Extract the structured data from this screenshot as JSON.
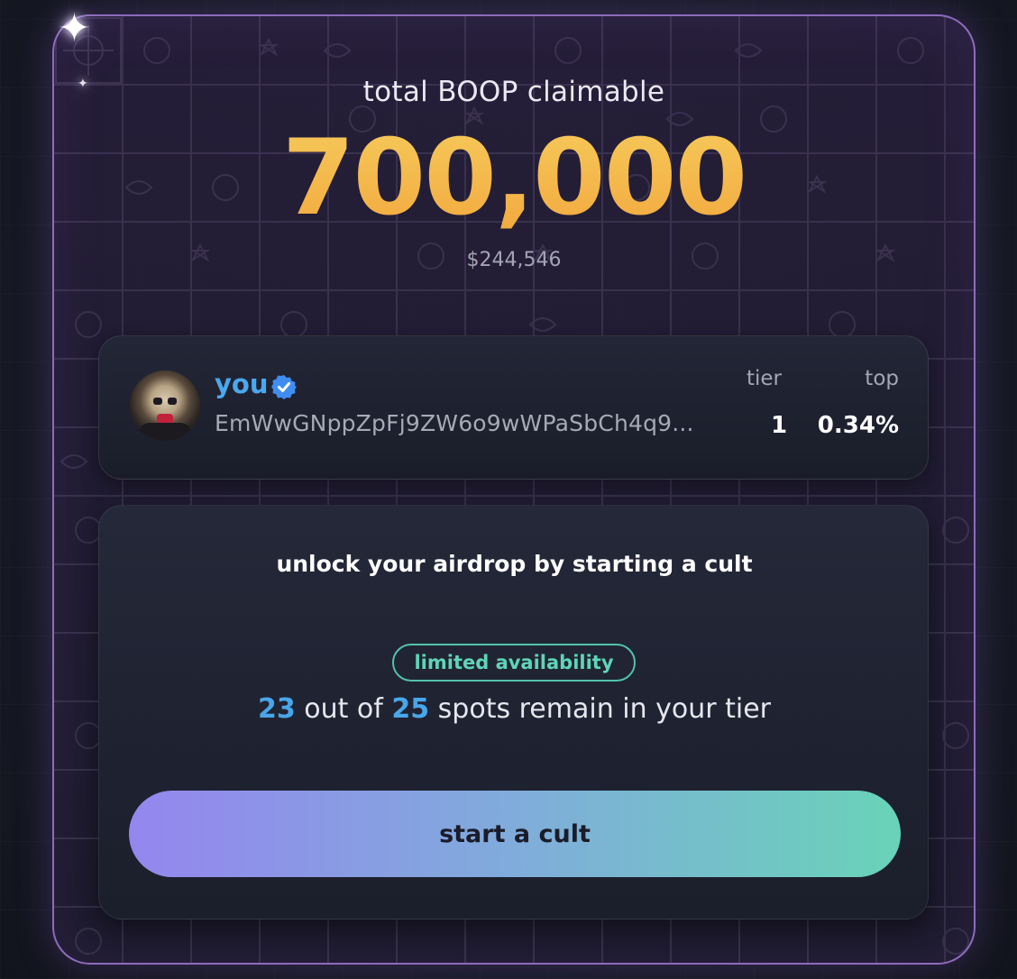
{
  "claim": {
    "label": "total BOOP claimable",
    "amount": "700,000",
    "usd_value": "$244,546"
  },
  "user": {
    "name": "you",
    "verified": true,
    "wallet_address": "EmWwGNppZpFj9ZW6o9wWPaSbCh4q9...",
    "stats": {
      "tier_label": "tier",
      "tier_value": "1",
      "top_label": "top",
      "top_value": "0.34%"
    }
  },
  "cult": {
    "heading": "unlock your airdrop by starting a cult",
    "badge": "limited availability",
    "spots_remaining": "23",
    "spots_mid": " out of ",
    "spots_total": "25",
    "spots_suffix": " spots remain in your tier",
    "cta_label": "start a cult"
  },
  "colors": {
    "amount_gold": "#f2a93f",
    "accent_blue": "#4aa8ee",
    "badge_teal": "#53c2ac",
    "card_border": "#8e6bbd"
  },
  "icons": {
    "verified": "verified-check-badge-icon",
    "sparkle": "sparkle-icon"
  }
}
